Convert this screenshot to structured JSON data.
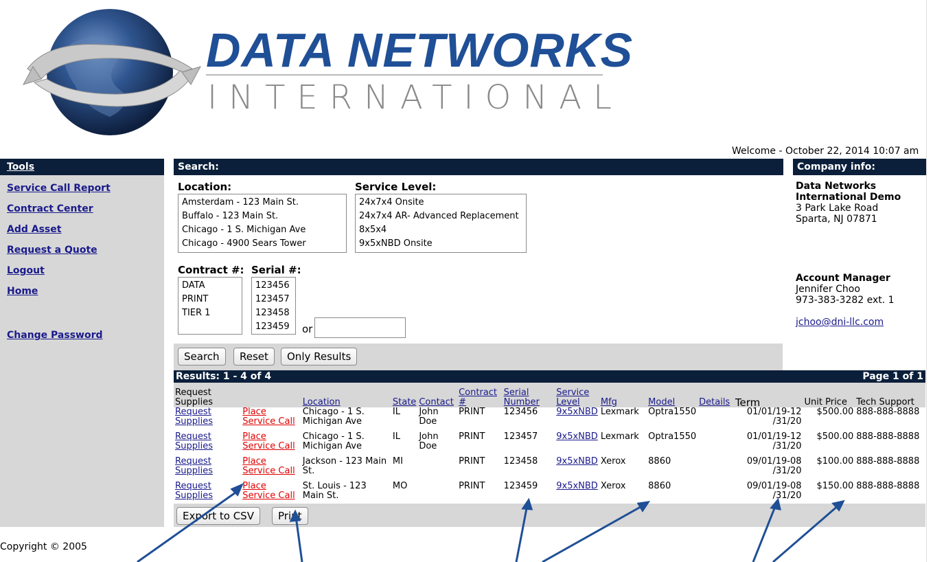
{
  "header": {
    "title": "DATA NETWORKS",
    "subtitle": "INTERNATIONAL",
    "welcome": "Welcome - October 22, 2014 10:07 am"
  },
  "sidebar": {
    "heading": "Tools",
    "items": [
      {
        "label": "Service Call Report"
      },
      {
        "label": "Contract Center"
      },
      {
        "label": "Add Asset"
      },
      {
        "label": "Request a Quote"
      },
      {
        "label": "Logout"
      },
      {
        "label": "Home"
      },
      {
        "label": "Change Password"
      }
    ]
  },
  "search": {
    "heading": "Search:",
    "location_label": "Location:",
    "locations": [
      "Amsterdam - 123 Main St.",
      "Buffalo - 123 Main St.",
      "Chicago - 1 S. Michigan Ave",
      "Chicago - 4900 Sears Tower"
    ],
    "service_level_label": "Service Level:",
    "service_levels": [
      "24x7x4 Onsite",
      "24x7x4 AR- Advanced Replacement",
      "8x5x4",
      "9x5xNBD Onsite"
    ],
    "contract_label": "Contract #:",
    "contracts": [
      "DATA",
      "PRINT",
      "TIER 1"
    ],
    "serial_label": "Serial #:",
    "serials": [
      "123456",
      "123457",
      "123458",
      "123459"
    ],
    "or_label": "or",
    "serial_input_value": "",
    "buttons": {
      "search": "Search",
      "reset": "Reset",
      "only_results": "Only Results"
    }
  },
  "results": {
    "summary": "Results: 1 - 4 of 4",
    "page": "Page 1 of 1",
    "columns": {
      "request": "Request Supplies",
      "location": "Location",
      "state": "State",
      "contact": "Contact",
      "contract": "Contract #",
      "serial": "Serial Number",
      "service": "Service Level",
      "mfg": "Mfg",
      "model": "Model",
      "details": "Details",
      "term": "Term",
      "price": "Unit Price",
      "support": "Tech Support"
    },
    "rows": [
      {
        "request": "Request Supplies",
        "call": "Place Service Call",
        "location": "Chicago - 1 S. Michigan Ave",
        "state": "IL",
        "contact": "John Doe",
        "contract": "PRINT",
        "serial": "123456",
        "service": "9x5xNBD",
        "mfg": "Lexmark",
        "model": "Optra1550",
        "term": "01/01/19-12 /31/20",
        "price": "$500.00",
        "support": "888-888-8888"
      },
      {
        "request": "Request Supplies",
        "call": "Place Service Call",
        "location": "Chicago - 1 S. Michigan Ave",
        "state": "IL",
        "contact": "John Doe",
        "contract": "PRINT",
        "serial": "123457",
        "service": "9x5xNBD",
        "mfg": "Lexmark",
        "model": "Optra1550",
        "term": "01/01/19-12 /31/20",
        "price": "$500.00",
        "support": "888-888-8888"
      },
      {
        "request": "Request Supplies",
        "call": "Place Service Call",
        "location": "Jackson - 123 Main St.",
        "state": "MI",
        "contact": "",
        "contract": "PRINT",
        "serial": "123458",
        "service": "9x5xNBD",
        "mfg": "Xerox",
        "model": "8860",
        "term": "09/01/19-08 /31/20",
        "price": "$100.00",
        "support": "888-888-8888"
      },
      {
        "request": "Request Supplies",
        "call": "Place Service Call",
        "location": "St. Louis - 123 Main St.",
        "state": "MO",
        "contact": "",
        "contract": "PRINT",
        "serial": "123459",
        "service": "9x5xNBD",
        "mfg": "Xerox",
        "model": "8860",
        "term": "09/01/19-08 /31/20",
        "price": "$150.00",
        "support": "888-888-8888"
      }
    ],
    "buttons": {
      "export": "Export to CSV",
      "print": "Print"
    }
  },
  "company": {
    "heading": "Company info:",
    "name": "Data Networks International Demo",
    "address1": "3 Park Lake Road",
    "address2": "Sparta,  NJ  07871",
    "manager_heading": "Account Manager",
    "manager_name": "Jennifer Choo",
    "manager_phone": "973-383-3282 ext. 1",
    "manager_email": "jchoo@dni-llc.com"
  },
  "footer": {
    "copyright": "Copyright © 2005"
  },
  "colors": {
    "navy": "#0b1f3a",
    "gray_panel": "#d7d7d7",
    "link": "#1a1a8c",
    "red_link": "#e00000",
    "logo_blue": "#1f4f96",
    "arrow": "#1f4f96"
  }
}
